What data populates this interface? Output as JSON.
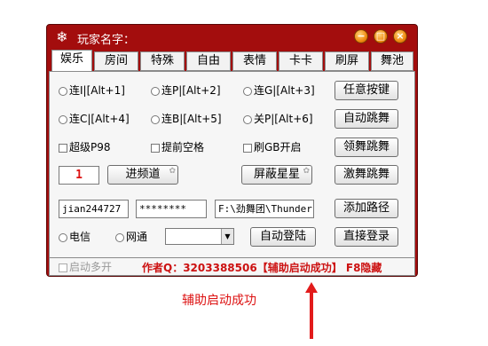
{
  "window": {
    "title": "玩家名字：",
    "controls": {
      "minimize": "−",
      "maximize": "□",
      "close": "×"
    }
  },
  "tabs": [
    "娱乐",
    "房间",
    "特殊",
    "自由",
    "表情",
    "卡卡",
    "刷屏",
    "舞池"
  ],
  "panel": {
    "radios_row1": [
      "连I|[Alt+1]",
      "连P|[Alt+2]",
      "连G|[Alt+3]"
    ],
    "radios_row2": [
      "连C|[Alt+4]",
      "连B|[Alt+5]",
      "关P|[Alt+6]"
    ],
    "checks": [
      "超级P98",
      "提前空格",
      "刷GB开启"
    ],
    "buttons": {
      "any_key": "任意按键",
      "auto_dance": "自动跳舞",
      "lead_dance": "领舞跳舞",
      "passion_dance": "激舞跳舞",
      "enter_channel": "进频道",
      "block_stars": "屏蔽星星",
      "add_path": "添加路径",
      "auto_login": "自动登陆",
      "direct_login": "直接登录"
    },
    "channel_value": "1",
    "username": "jian244727",
    "password": "********",
    "path": "F:\\劲舞团\\Thunder.",
    "network": [
      "电信",
      "网通"
    ]
  },
  "statusbar": {
    "multi_open": "启动多开",
    "author": "作者Q：3203388506【辅助启动成功】 F8隐藏"
  },
  "annotation": {
    "caption": "辅助启动成功"
  },
  "colors": {
    "window_frame": "#a30d0d",
    "accent_red": "#cc1111"
  }
}
